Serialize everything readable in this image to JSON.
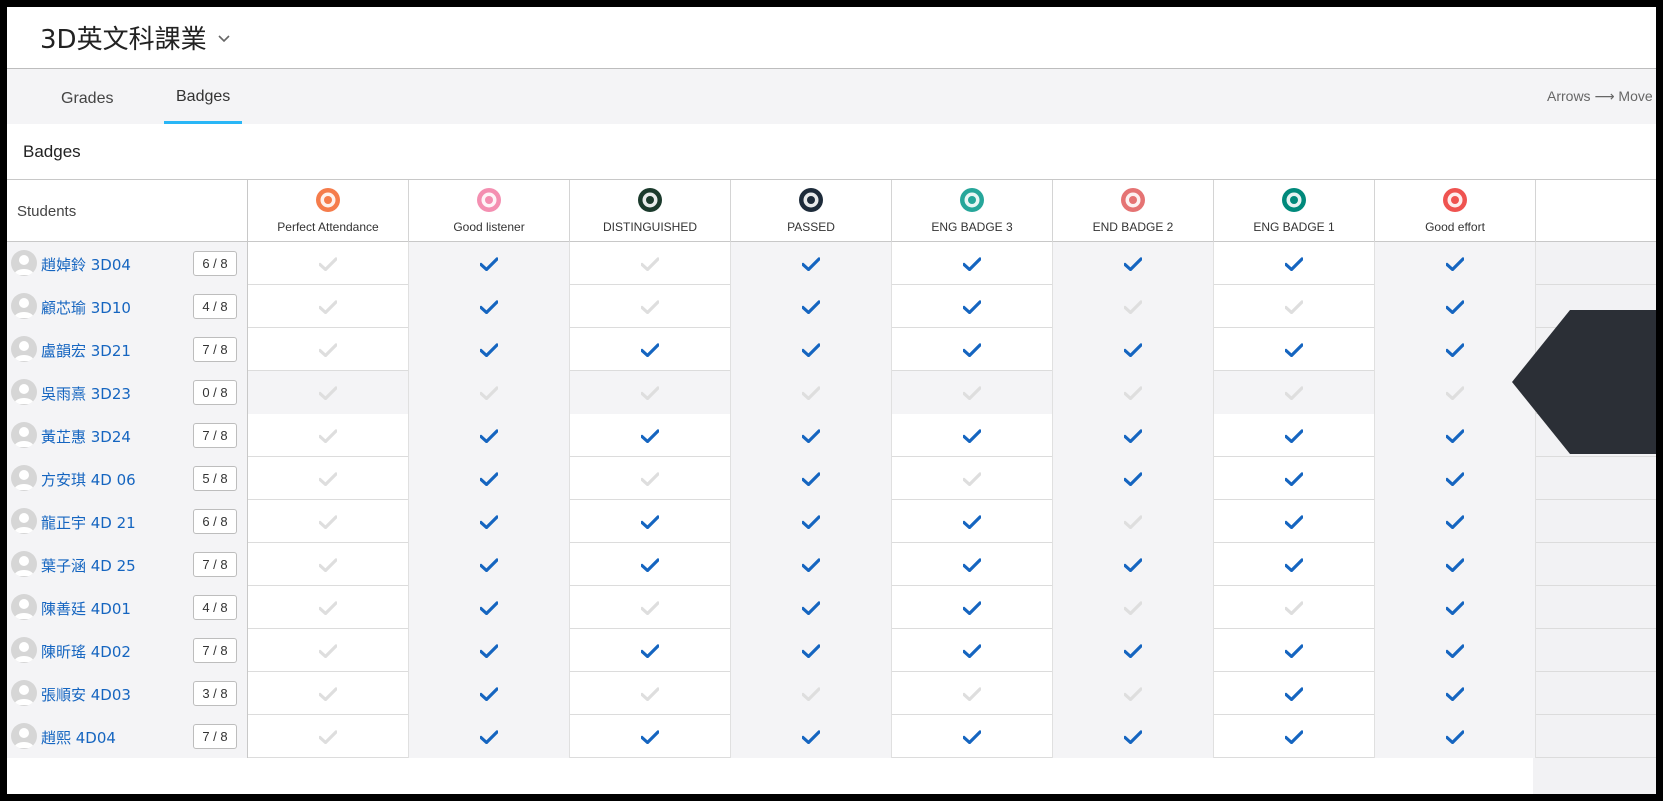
{
  "header": {
    "course_title": "3D英文科課業"
  },
  "tabs": [
    {
      "label": "Grades"
    },
    {
      "label": "Badges"
    }
  ],
  "keyboard_hint": "Arrows ⟶ Move",
  "section_title": "Badges",
  "table": {
    "students_header": "Students",
    "badges": [
      {
        "name": "Perfect Attendance",
        "icon": "attendance-badge-icon",
        "color": "#f57c4b"
      },
      {
        "name": "Good listener",
        "icon": "good-listener-badge-icon",
        "color": "#f48fb1"
      },
      {
        "name": "DISTINGUISHED",
        "icon": "distinguished-badge-icon",
        "color": "#1b3a2c"
      },
      {
        "name": "PASSED",
        "icon": "passed-badge-icon",
        "color": "#1d2b3a"
      },
      {
        "name": "ENG BADGE 3",
        "icon": "eng-badge-3-icon",
        "color": "#26a69a"
      },
      {
        "name": "END BADGE 2",
        "icon": "end-badge-2-icon",
        "color": "#e57373"
      },
      {
        "name": "ENG BADGE 1",
        "icon": "eng-badge-1-icon",
        "color": "#00897b"
      },
      {
        "name": "Good effort",
        "icon": "good-effort-badge-icon",
        "color": "#ef5350"
      }
    ],
    "students": [
      {
        "name": "趙婥鈴 3D04",
        "count": "6 / 8",
        "awarded": [
          false,
          true,
          false,
          true,
          true,
          true,
          true,
          true
        ]
      },
      {
        "name": "顧芯瑜 3D10",
        "count": "4 / 8",
        "awarded": [
          false,
          true,
          false,
          true,
          true,
          false,
          false,
          true
        ]
      },
      {
        "name": "盧韻宏 3D21",
        "count": "7 / 8",
        "awarded": [
          false,
          true,
          true,
          true,
          true,
          true,
          true,
          true
        ]
      },
      {
        "name": "吳雨熹 3D23",
        "count": "0 / 8",
        "awarded": [
          false,
          false,
          false,
          false,
          false,
          false,
          false,
          false
        ]
      },
      {
        "name": "黃芷惠 3D24",
        "count": "7 / 8",
        "awarded": [
          false,
          true,
          true,
          true,
          true,
          true,
          true,
          true
        ]
      },
      {
        "name": "方安琪 4D 06",
        "count": "5 / 8",
        "awarded": [
          false,
          true,
          false,
          true,
          false,
          true,
          true,
          true
        ]
      },
      {
        "name": "龍正宇 4D 21",
        "count": "6 / 8",
        "awarded": [
          false,
          true,
          true,
          true,
          true,
          false,
          true,
          true
        ]
      },
      {
        "name": "葉子涵 4D 25",
        "count": "7 / 8",
        "awarded": [
          false,
          true,
          true,
          true,
          true,
          true,
          true,
          true
        ]
      },
      {
        "name": "陳善廷 4D01",
        "count": "4 / 8",
        "awarded": [
          false,
          true,
          false,
          true,
          true,
          false,
          false,
          true
        ]
      },
      {
        "name": "陳昕瑤 4D02",
        "count": "7 / 8",
        "awarded": [
          false,
          true,
          true,
          true,
          true,
          true,
          true,
          true
        ]
      },
      {
        "name": "張順安 4D03",
        "count": "3 / 8",
        "awarded": [
          false,
          true,
          false,
          false,
          false,
          false,
          true,
          true
        ]
      },
      {
        "name": "趙熙 4D04",
        "count": "7 / 8",
        "awarded": [
          false,
          true,
          true,
          true,
          true,
          true,
          true,
          true
        ]
      }
    ]
  },
  "colors": {
    "check_on": "#1565c0",
    "check_off": "#dedede",
    "tab_underline": "#29b6f6",
    "link": "#1565c0"
  }
}
